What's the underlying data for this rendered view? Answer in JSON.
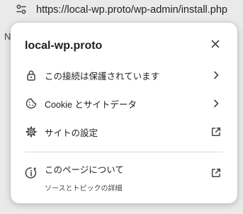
{
  "address_bar": {
    "url": "https://local-wp.proto/wp-admin/install.php"
  },
  "background_text": "N",
  "popup": {
    "title": "local-wp.proto",
    "items": [
      {
        "label": "この接続は保護されています",
        "icon": "lock-icon",
        "end_icon": "chevron-right-icon"
      },
      {
        "label": "Cookie とサイトデータ",
        "icon": "cookie-icon",
        "end_icon": "chevron-right-icon"
      },
      {
        "label": "サイトの設定",
        "icon": "gear-icon",
        "end_icon": "open-in-new-icon"
      }
    ],
    "about": {
      "label": "このページについて",
      "sublabel": "ソースとトピックの詳細",
      "icon": "info-sparkle-icon",
      "end_icon": "open-in-new-icon"
    }
  },
  "colors": {
    "popup_bg": "#ffffff",
    "page_bg": "#eaeaea",
    "text": "#1f1f1f",
    "divider": "#dadce0"
  }
}
